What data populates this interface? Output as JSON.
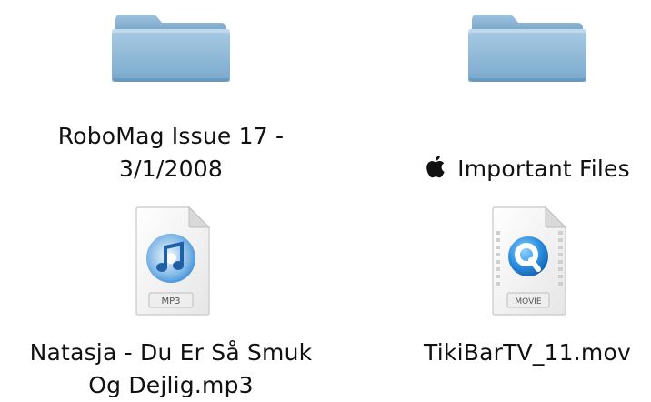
{
  "finder": {
    "items": [
      {
        "kind": "folder",
        "icon": "folder-icon",
        "name": "RoboMag Issue 17 -\n3/1/2008",
        "has_apple_badge": false
      },
      {
        "kind": "folder",
        "icon": "folder-icon",
        "name": "Important Files",
        "has_apple_badge": true
      },
      {
        "kind": "document",
        "icon": "mp3-file-icon",
        "badge": "MP3",
        "name": "Natasja - Du Er Så Smuk\nOg Dejlig.mp3"
      },
      {
        "kind": "document",
        "icon": "movie-file-icon",
        "badge": "MOVIE",
        "name": "TikiBarTV_11.mov"
      }
    ]
  },
  "colors": {
    "folder": "#8fb7d6",
    "folder_dark": "#6f9cbf",
    "document_page": "#f4f4f4",
    "itunes_blue": "#3b8ed8",
    "quicktime_blue": "#1f7fd1"
  }
}
